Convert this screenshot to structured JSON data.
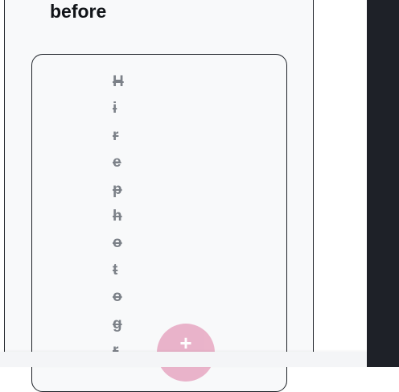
{
  "heading": "before",
  "card": {
    "letters": [
      "H",
      "i",
      "r",
      "e",
      "p",
      "h",
      "o",
      "t",
      "o",
      "g",
      "r"
    ]
  },
  "fab": {
    "label": "+"
  },
  "colors": {
    "fab": "#e8aec6",
    "dark_strip": "#1e2128",
    "text": "#111418",
    "struck_text": "#7c8188"
  }
}
